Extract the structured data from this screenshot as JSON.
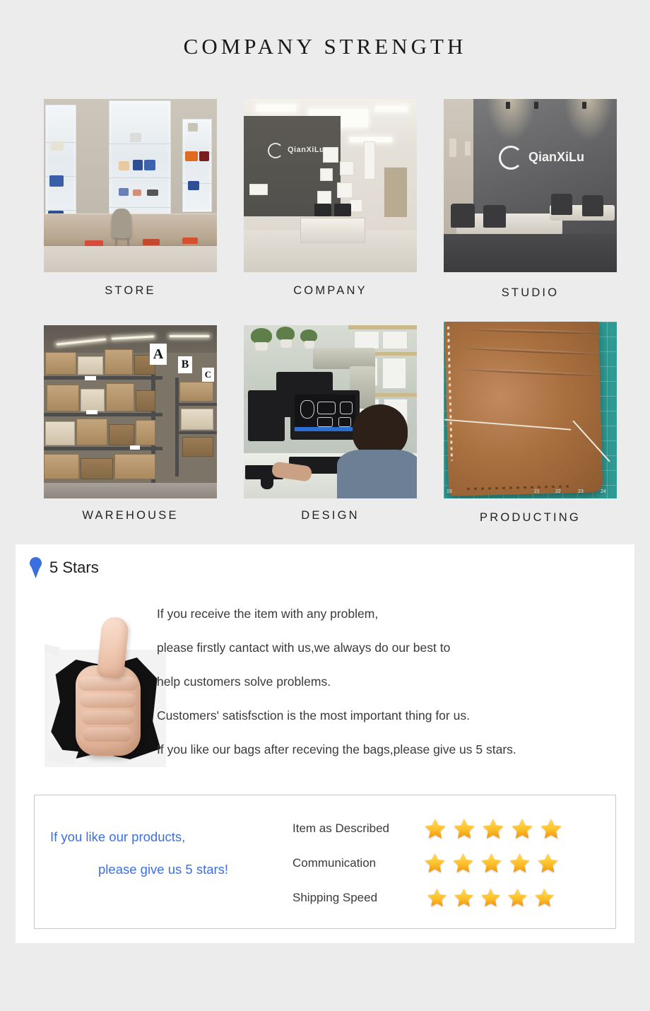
{
  "header": {
    "title": "COMPANY STRENGTH"
  },
  "gallery": {
    "items": [
      {
        "caption": "STORE",
        "photo": "retail-store-display-cases"
      },
      {
        "caption": "COMPANY",
        "photo": "office-reception-lobby"
      },
      {
        "caption": "STUDIO",
        "photo": "meeting-room-logo-wall"
      },
      {
        "caption": "WAREHOUSE",
        "photo": "warehouse-shelves-boxes"
      },
      {
        "caption": "DESIGN",
        "photo": "designer-at-computer"
      },
      {
        "caption": "PRODUCTING",
        "photo": "brown-leather-on-cutting-mat"
      }
    ]
  },
  "brand": {
    "name": "QianXiLu"
  },
  "warehouse_signs": [
    "A",
    "B",
    "C"
  ],
  "stars_card": {
    "heading": "5 Stars",
    "pin_color": "#3b6fe0",
    "paragraph": [
      "If you receive the item with any problem,",
      "please firstly cantact with us,we always do our best to",
      "help customers solve problems.",
      "Customers' satisfsction is the most important thing for us.",
      "If you like our bags after receving the bags,please give us 5 stars."
    ]
  },
  "review_box": {
    "promo": {
      "line1": "If you like our products,",
      "line2": "please give us 5 stars!",
      "color": "#3c6fe0"
    },
    "ratings": [
      {
        "label": "Item as Described",
        "stars": 5
      },
      {
        "label": "Communication",
        "stars": 5
      },
      {
        "label": "Shipping Speed",
        "stars": 5
      }
    ],
    "star_color_top": "#ffd24d",
    "star_color_bottom": "#f5a623"
  },
  "theme": {
    "page_background": "#ececec",
    "card_background": "#ffffff",
    "text_color": "#3a3a3a"
  }
}
